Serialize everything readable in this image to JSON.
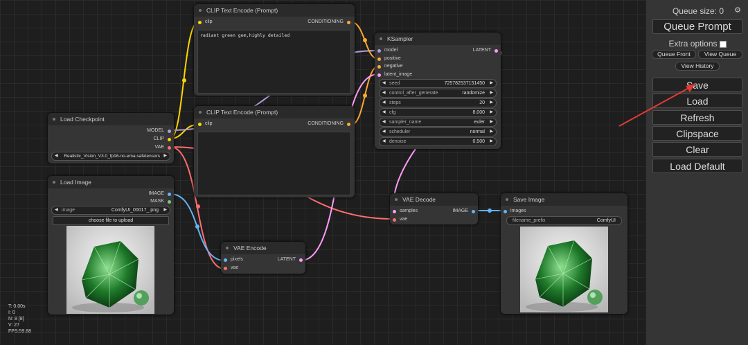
{
  "panel": {
    "queue_size": "Queue size: 0",
    "queue_prompt": "Queue Prompt",
    "extra_options": "Extra options",
    "queue_front": "Queue Front",
    "view_queue": "View Queue",
    "view_history": "View History",
    "save": "Save",
    "load": "Load",
    "refresh": "Refresh",
    "clipspace": "Clipspace",
    "clear": "Clear",
    "load_default": "Load Default"
  },
  "stats": [
    "T: 0.00s",
    "I: 0",
    "N: 8 [8]",
    "V: 27",
    "FPS:59.88"
  ],
  "nodes": {
    "clip_pos": {
      "title": "CLIP Text Encode (Prompt)",
      "in_clip": "clip",
      "out": "CONDITIONING",
      "text": "radiant green gem,highly detailed"
    },
    "clip_neg": {
      "title": "CLIP Text Encode (Prompt)",
      "in_clip": "clip",
      "out": "CONDITIONING",
      "text": ""
    },
    "ksampler": {
      "title": "KSampler",
      "inputs": [
        "model",
        "positive",
        "negative",
        "latent_image"
      ],
      "out": "LATENT",
      "widgets": [
        {
          "label": "seed",
          "value": "725782537151450"
        },
        {
          "label": "control_after_generate",
          "value": "randomize"
        },
        {
          "label": "steps",
          "value": "20"
        },
        {
          "label": "cfg",
          "value": "8.000"
        },
        {
          "label": "sampler_name",
          "value": "euler"
        },
        {
          "label": "scheduler",
          "value": "normal"
        },
        {
          "label": "denoise",
          "value": "0.500"
        }
      ]
    },
    "checkpoint": {
      "title": "Load Checkpoint",
      "outs": [
        "MODEL",
        "CLIP",
        "VAE"
      ],
      "ckpt": "Realistic_Vision_V3.0_fp16-no-ema.safetensors"
    },
    "load_image": {
      "title": "Load Image",
      "outs": [
        "IMAGE",
        "MASK"
      ],
      "image_label": "image",
      "image_value": "ComfyUI_00017_.png",
      "upload": "choose file to upload"
    },
    "vae_encode": {
      "title": "VAE Encode",
      "inputs": [
        "pixels",
        "vae"
      ],
      "out": "LATENT"
    },
    "vae_decode": {
      "title": "VAE Decode",
      "inputs": [
        "samples",
        "vae"
      ],
      "out": "IMAGE"
    },
    "save_image": {
      "title": "Save Image",
      "in": "images",
      "prefix_label": "filename_prefix",
      "prefix_value": "ComfyUI"
    }
  },
  "colors": {
    "model": "#b39ddb",
    "clip": "#ffd500",
    "vae": "#ff6e6e",
    "conditioning": "#ffa931",
    "latent": "#ff9cf9",
    "image": "#64b5f6",
    "mask": "#81c784",
    "arrow": "#e53935"
  }
}
